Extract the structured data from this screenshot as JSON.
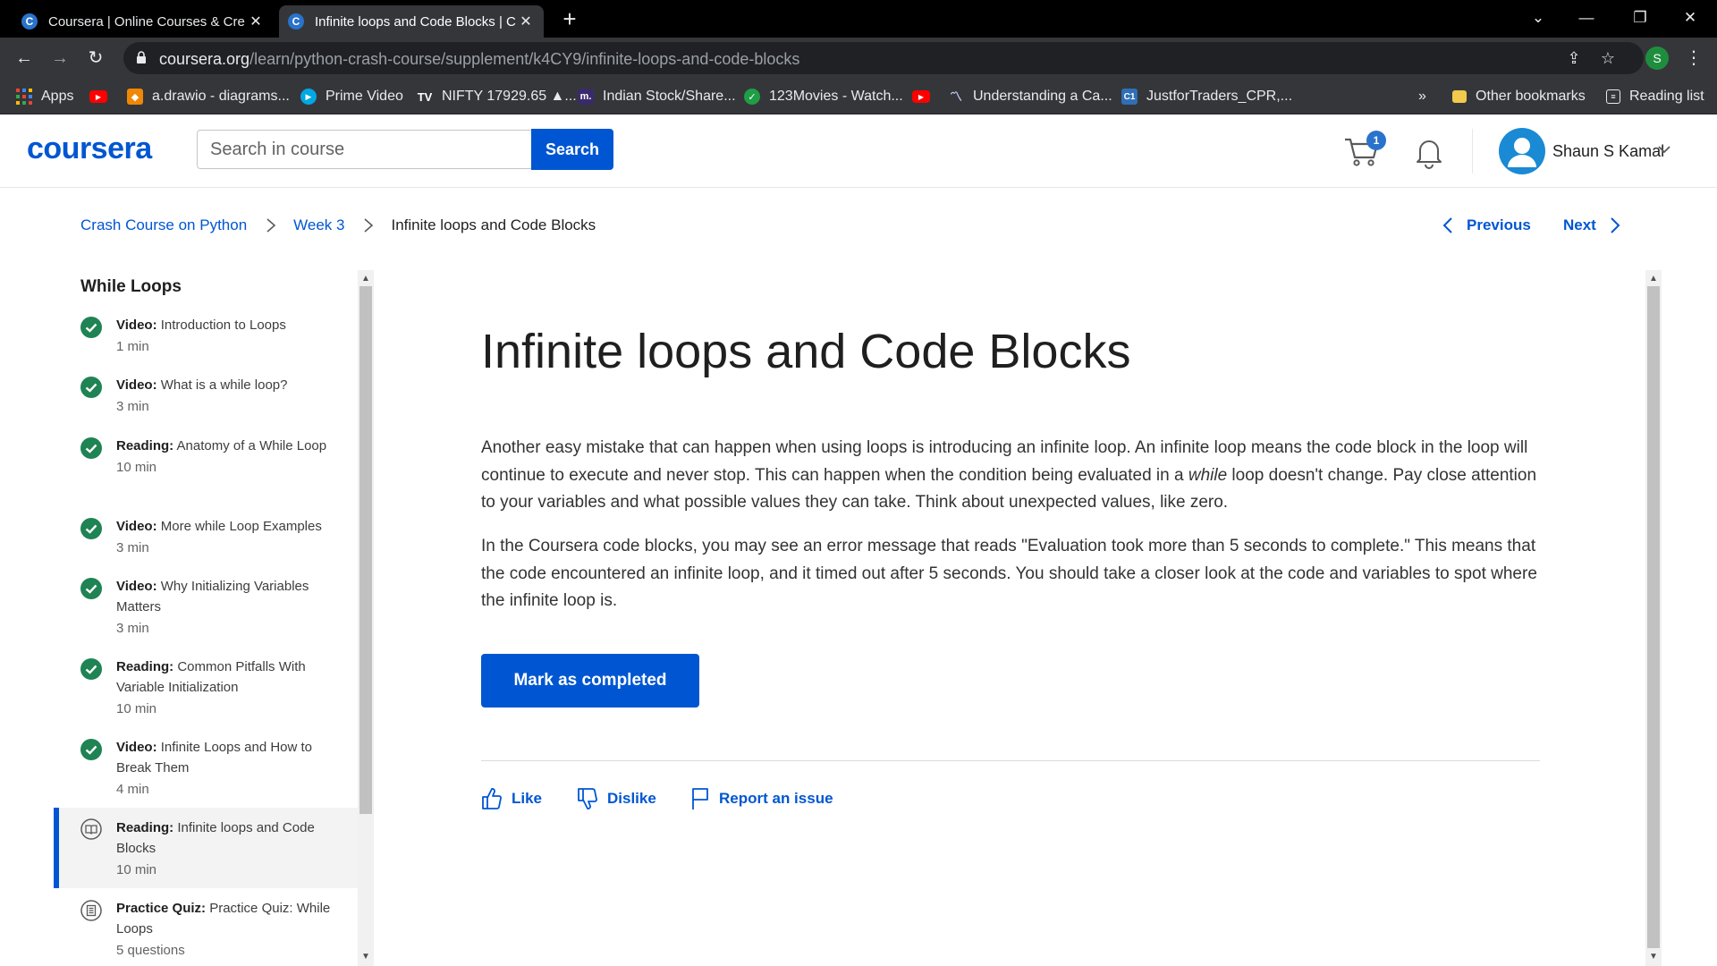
{
  "browser": {
    "tabs": [
      {
        "title": "Coursera | Online Courses & Cre",
        "favicon": "C",
        "active": false
      },
      {
        "title": "Infinite loops and Code Blocks | C",
        "favicon": "C",
        "active": true
      }
    ],
    "url_domain": "coursera.org",
    "url_path": "/learn/python-crash-course/supplement/k4CY9/infinite-loops-and-code-blocks",
    "profile_initial": "S",
    "bookmarks": [
      {
        "label": "Apps",
        "icon": "apps-grid-icon"
      },
      {
        "label": "",
        "icon": "youtube-icon"
      },
      {
        "label": "a.drawio - diagrams...",
        "icon": "drawio-icon"
      },
      {
        "label": "Prime Video",
        "icon": "prime-video-icon"
      },
      {
        "label": "NIFTY 17929.65 ▲...",
        "icon": "tradingview-icon"
      },
      {
        "label": "Indian Stock/Share...",
        "icon": "moneycontrol-icon"
      },
      {
        "label": "123Movies - Watch...",
        "icon": "shield-check-icon"
      },
      {
        "label": "",
        "icon": "youtube-icon"
      },
      {
        "label": "Understanding a Ca...",
        "icon": "chart-icon"
      },
      {
        "label": "JustforTraders_CPR,...",
        "icon": "c1-icon"
      }
    ],
    "bookmarks_overflow": "»",
    "other_bookmarks": "Other bookmarks",
    "reading_list": "Reading list"
  },
  "header": {
    "logo": "coursera",
    "search_placeholder": "Search in course",
    "search_button": "Search",
    "cart_count": "1",
    "user_name": "Shaun S Kamal"
  },
  "breadcrumb": {
    "course": "Crash Course on Python",
    "week": "Week 3",
    "current": "Infinite loops and Code Blocks"
  },
  "nav": {
    "previous": "Previous",
    "next": "Next"
  },
  "sidebar": {
    "title": "While Loops",
    "items": [
      {
        "type": "Video:",
        "title": "Introduction to Loops",
        "duration": "1 min",
        "status": "completed"
      },
      {
        "type": "Video:",
        "title": "What is a while loop?",
        "duration": "3 min",
        "status": "completed"
      },
      {
        "type": "Reading:",
        "title": "Anatomy of a While Loop",
        "duration": "10 min",
        "status": "completed"
      },
      {
        "type": "Video:",
        "title": "More while Loop Examples",
        "duration": "3 min",
        "status": "completed"
      },
      {
        "type": "Video:",
        "title": "Why Initializing Variables Matters",
        "duration": "3 min",
        "status": "completed"
      },
      {
        "type": "Reading:",
        "title": "Common Pitfalls With Variable Initialization",
        "duration": "10 min",
        "status": "completed"
      },
      {
        "type": "Video:",
        "title": "Infinite Loops and How to Break Them",
        "duration": "4 min",
        "status": "completed"
      },
      {
        "type": "Reading:",
        "title": "Infinite loops and Code Blocks",
        "duration": "10 min",
        "status": "current"
      },
      {
        "type": "Practice Quiz:",
        "title": "Practice Quiz: While Loops",
        "duration": "5 questions",
        "status": "not-started"
      }
    ]
  },
  "content": {
    "title": "Infinite loops and Code Blocks",
    "para1_before": "Another easy mistake that can happen when using loops is introducing an infinite loop. An infinite loop means the code block in the loop will continue to execute and never stop. This can happen when the condition being evaluated in a ",
    "para1_italic": "while",
    "para1_after": " loop doesn't change. Pay close attention to your variables and what possible values they can take. Think about unexpected values, like zero.",
    "para2": "In the Coursera code blocks, you may see an error message that reads \"Evaluation took more than 5 seconds to complete.\" This means that the code encountered an infinite loop, and it timed out after 5 seconds. You should take a closer look at the code and variables to spot where the infinite loop is.",
    "mark_completed": "Mark as completed",
    "like": "Like",
    "dislike": "Dislike",
    "report": "Report an issue"
  },
  "colors": {
    "brand_blue": "#0056d2",
    "complete_green": "#1f8354",
    "chrome_dark": "#35363a"
  }
}
